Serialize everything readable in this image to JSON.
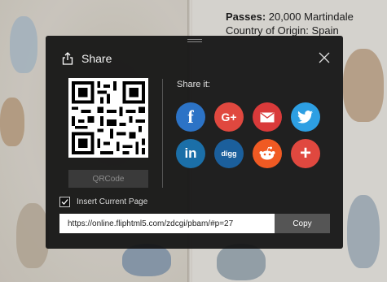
{
  "background": {
    "text_line1_label": "Passes:",
    "text_line1_value": " 20,000 Martindale",
    "text_line2": "Country of Origin: Spain"
  },
  "dialog": {
    "title": "Share",
    "share_it_label": "Share it:",
    "qrcode_button": "QRCode",
    "insert_current_page_label": "Insert Current Page",
    "insert_current_page_checked": true,
    "url_value": "https://online.fliphtml5.com/zdcgi/pbam/#p=27",
    "copy_button": "Copy"
  },
  "social": [
    {
      "name": "facebook",
      "glyph": "f",
      "color": "#2c73c6"
    },
    {
      "name": "google-plus",
      "glyph": "G+",
      "color": "#e0483f"
    },
    {
      "name": "email",
      "glyph": "✉",
      "color": "#d93a3a"
    },
    {
      "name": "twitter",
      "glyph": "🐦",
      "color": "#2d9fe3"
    },
    {
      "name": "linkedin",
      "glyph": "in",
      "color": "#1b6fa8"
    },
    {
      "name": "digg",
      "glyph": "digg",
      "color": "#1b5f9c"
    },
    {
      "name": "reddit",
      "glyph": "👽",
      "color": "#f05a23"
    },
    {
      "name": "more",
      "glyph": "+",
      "color": "#e0483f"
    }
  ]
}
